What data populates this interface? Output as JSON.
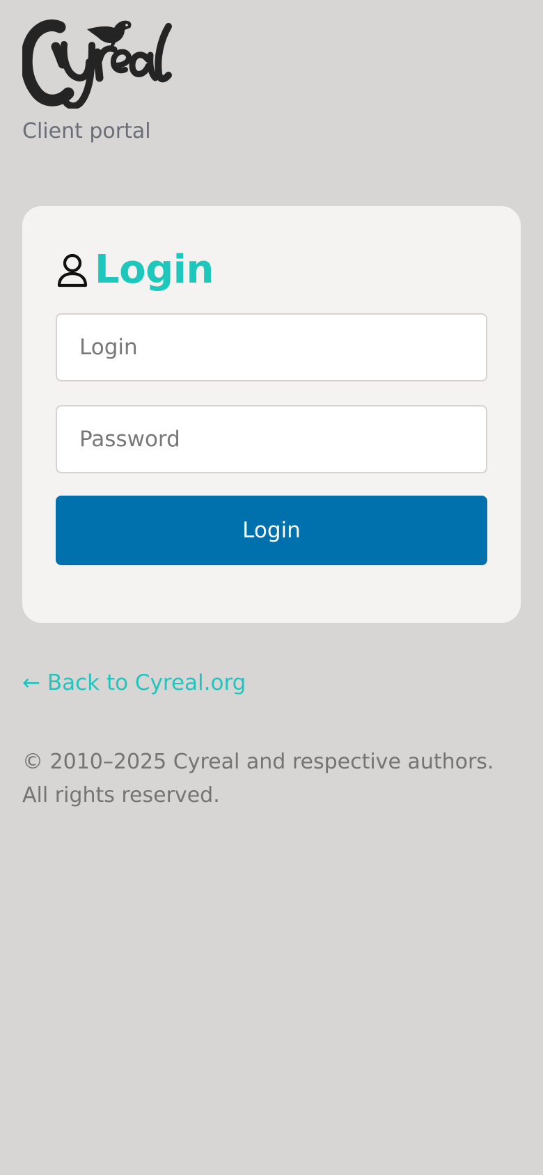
{
  "brand": {
    "logo_text": "Cyreal",
    "logo_icon": "bird-icon",
    "subtitle": "Client portal"
  },
  "card": {
    "icon": "user-icon",
    "title": "Login",
    "login_placeholder": "Login",
    "login_value": "",
    "password_placeholder": "Password",
    "password_value": "",
    "button_label": "Login",
    "button_color": "#0071ad",
    "accent_color": "#1ec7bc"
  },
  "links": {
    "back": "← Back to Cyreal.org"
  },
  "footer": {
    "copyright": "© 2010–2025 Cyreal and respective authors. All rights reserved."
  }
}
